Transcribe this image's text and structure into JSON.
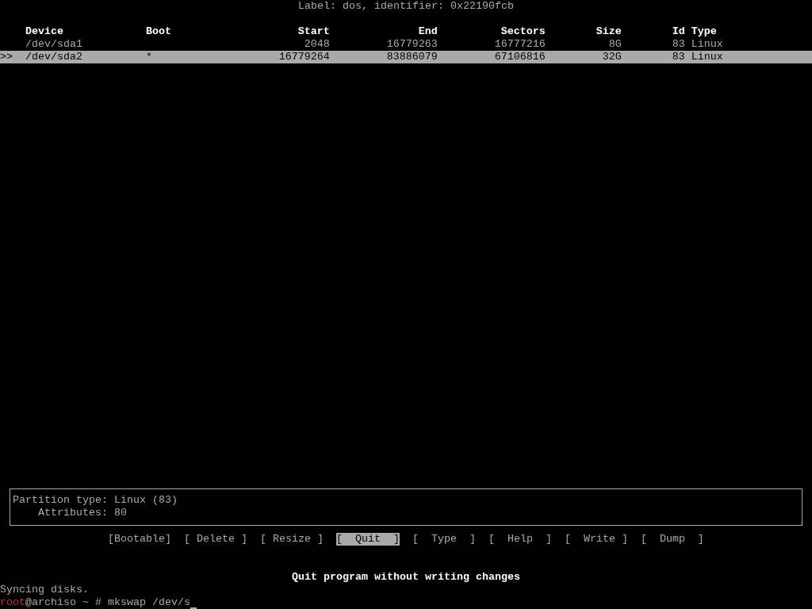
{
  "disk_label": "Label: dos, identifier: 0x22190fcb",
  "table": {
    "cursor": ">>",
    "columns": [
      "Device",
      "Boot",
      "Start",
      "End",
      "Sectors",
      "Size",
      "Id",
      "Type"
    ],
    "rows": [
      {
        "selected": false,
        "cells": [
          "/dev/sda1",
          "",
          "2048",
          "16779263",
          "16777216",
          "8G",
          "83",
          "Linux"
        ]
      },
      {
        "selected": true,
        "cells": [
          "/dev/sda2",
          "*",
          "16779264",
          "83886079",
          "67106816",
          "32G",
          "83",
          "Linux"
        ]
      }
    ]
  },
  "info": [
    {
      "label": "Partition type:",
      "value": "Linux (83)"
    },
    {
      "label": "Attributes:",
      "value": "80"
    }
  ],
  "actions": [
    {
      "label": "[Bootable]",
      "selected": false
    },
    {
      "label": "[ Delete ]",
      "selected": false
    },
    {
      "label": "[ Resize ]",
      "selected": false
    },
    {
      "label": "[  Quit  ]",
      "selected": true
    },
    {
      "label": "[  Type  ]",
      "selected": false
    },
    {
      "label": "[  Help  ]",
      "selected": false
    },
    {
      "label": "[  Write ]",
      "selected": false
    },
    {
      "label": "[  Dump  ]",
      "selected": false
    }
  ],
  "action_hint": "Quit program without writing changes",
  "terminal": {
    "output": "Syncing disks.",
    "prompt_user": "root",
    "prompt_rest": "@archiso ~ # mkswap /dev/s"
  }
}
